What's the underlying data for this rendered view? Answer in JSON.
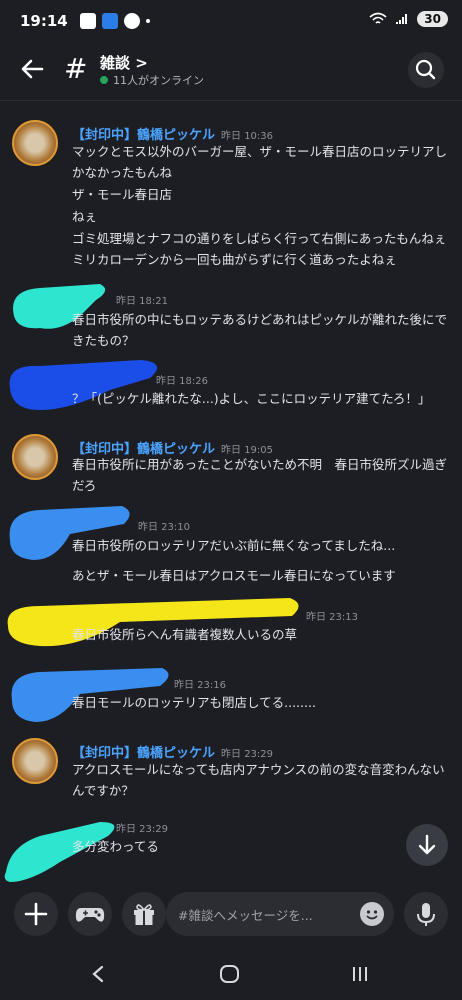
{
  "status_bar": {
    "time": "19:14",
    "battery": "30"
  },
  "header": {
    "channel_title": "雑談",
    "chevron": ">",
    "online_text": "11人がオンライン"
  },
  "messages": [
    {
      "author": "【封印中】鶴橋ピッケル",
      "time": "昨日 10:36",
      "lines": [
        "マックとモス以外のバーガー屋、ザ・モール春日店のロッテリアし",
        "かなかったもんね",
        "ザ・モール春日店",
        "ねぇ",
        "ゴミ処理場とナフコの通りをしばらく行って右側にあったもんねぇ",
        "ミリカローデンから一回も曲がらずに行く道あったよねぇ"
      ]
    },
    {
      "time": "昨日 18:21",
      "lines": [
        "春日市役所の中にもロッテあるけどあれはピッケルが離れた後にで",
        "きたもの？"
      ]
    },
    {
      "time": "昨日 18:26",
      "lines": [
        "？「(ピッケル離れたな...)よし、ここにロッテリア建てたろ！」"
      ]
    },
    {
      "author": "【封印中】鶴橋ピッケル",
      "time": "昨日 19:05",
      "lines": [
        "春日市役所に用があったことがないため不明　春日市役所ズル過ぎ",
        "だろ"
      ]
    },
    {
      "time": "昨日 23:10",
      "lines": [
        "春日市役所のロッテリアだいぶ前に無くなってましたね...",
        "あとザ・モール春日はアクロスモール春日になっています"
      ]
    },
    {
      "time": "昨日 23:13",
      "lines": [
        "春日市役所らへん有識者複数人いるの草"
      ]
    },
    {
      "time": "昨日 23:16",
      "lines": [
        "春日モールのロッテリアも閉店してる........"
      ]
    },
    {
      "author": "【封印中】鶴橋ピッケル",
      "time": "昨日 23:29",
      "lines": [
        "アクロスモールになっても店内アナウンスの前の変な音変わんない",
        "んですか？"
      ]
    },
    {
      "time": "昨日 23:29",
      "lines": [
        "多分変わってる"
      ]
    }
  ],
  "composer": {
    "placeholder": "#雑談へメッセージを..."
  },
  "colors": {
    "author": "#4ba3ff",
    "cyan_scribble": "#2ee6d0",
    "blue_scribble": "#1b4de8",
    "light_blue_scribble": "#3a8ef0",
    "yellow_scribble": "#f5e61a"
  },
  "icons": [
    "back-arrow-icon",
    "hash-icon",
    "search-icon",
    "scroll-down-icon",
    "plus-icon",
    "gamepad-icon",
    "gift-icon",
    "emoji-icon",
    "mic-icon",
    "nav-back-icon",
    "nav-home-icon",
    "nav-recents-icon"
  ]
}
